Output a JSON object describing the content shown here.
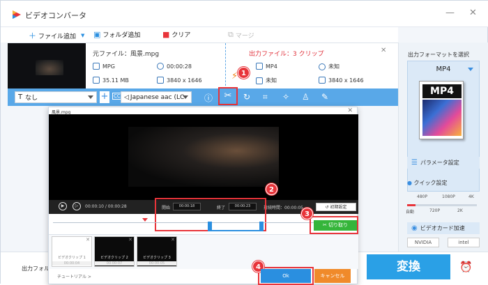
{
  "app": {
    "title": "ビデオコンバータ",
    "window_controls": {
      "minimize": "—",
      "close": "✕"
    }
  },
  "toolbar": {
    "add_file": "ファイル追加",
    "add_folder": "フォルダ追加",
    "clear": "クリア",
    "merge": "マージ"
  },
  "file": {
    "source_label": "元ファイル：風景.mpg",
    "src_format": "MPG",
    "src_duration": "00:00:28",
    "src_size": "35.11 MB",
    "src_resolution": "3840 x 1646",
    "output_label": "出力ファイル：3 クリップ",
    "out_format": "MP4",
    "out_duration": "未知",
    "out_size": "未知",
    "out_resolution": "3840 x 1646"
  },
  "editbar": {
    "subtitle": "なし",
    "audio": "Japanese aac (LC",
    "cc_label": "CC"
  },
  "right": {
    "header": "出力フォーマットを選択",
    "format": "MP4",
    "format_icon_label": "MP4",
    "param_button": "パラメータ設定",
    "quick_setting": "クイック設定",
    "ticks_top": [
      "480P",
      "1080P",
      "4K"
    ],
    "ticks_bottom": [
      "自動",
      "720P",
      "2K"
    ],
    "quality_level": 0.12,
    "gpu_button": "ビデオカード加速",
    "nvidia": "NVIDIA",
    "intel": "intel"
  },
  "bottom": {
    "output_folder": "出力フォル",
    "convert": "変換"
  },
  "dialog": {
    "title": "風景.mpg",
    "current_time": "00:00:10 / 00:00:28",
    "start_label": "開始",
    "start_value": "00:00:18",
    "end_label": "終了",
    "end_value": "00:00:23",
    "duration_label": "持続時間：00:00:05",
    "reset": "初期設定",
    "cut": "切り取り",
    "tutorial": "チュートリアル >",
    "ok": "Ok",
    "cancel": "キャンセル",
    "clips": [
      {
        "label": "ビデオクリップ 1",
        "time": "00:00:04"
      },
      {
        "label": "ビデオクリップ 2",
        "time": "00:00:07"
      },
      {
        "label": "ビデオクリップ 3",
        "time": "00:00:05"
      }
    ]
  },
  "callouts": [
    "1",
    "2",
    "3",
    "4"
  ],
  "colors": {
    "accent": "#59a8e8",
    "red": "#e8343a",
    "green": "#35b53a",
    "orange": "#f08a2a",
    "convert": "#2aa0e6"
  }
}
